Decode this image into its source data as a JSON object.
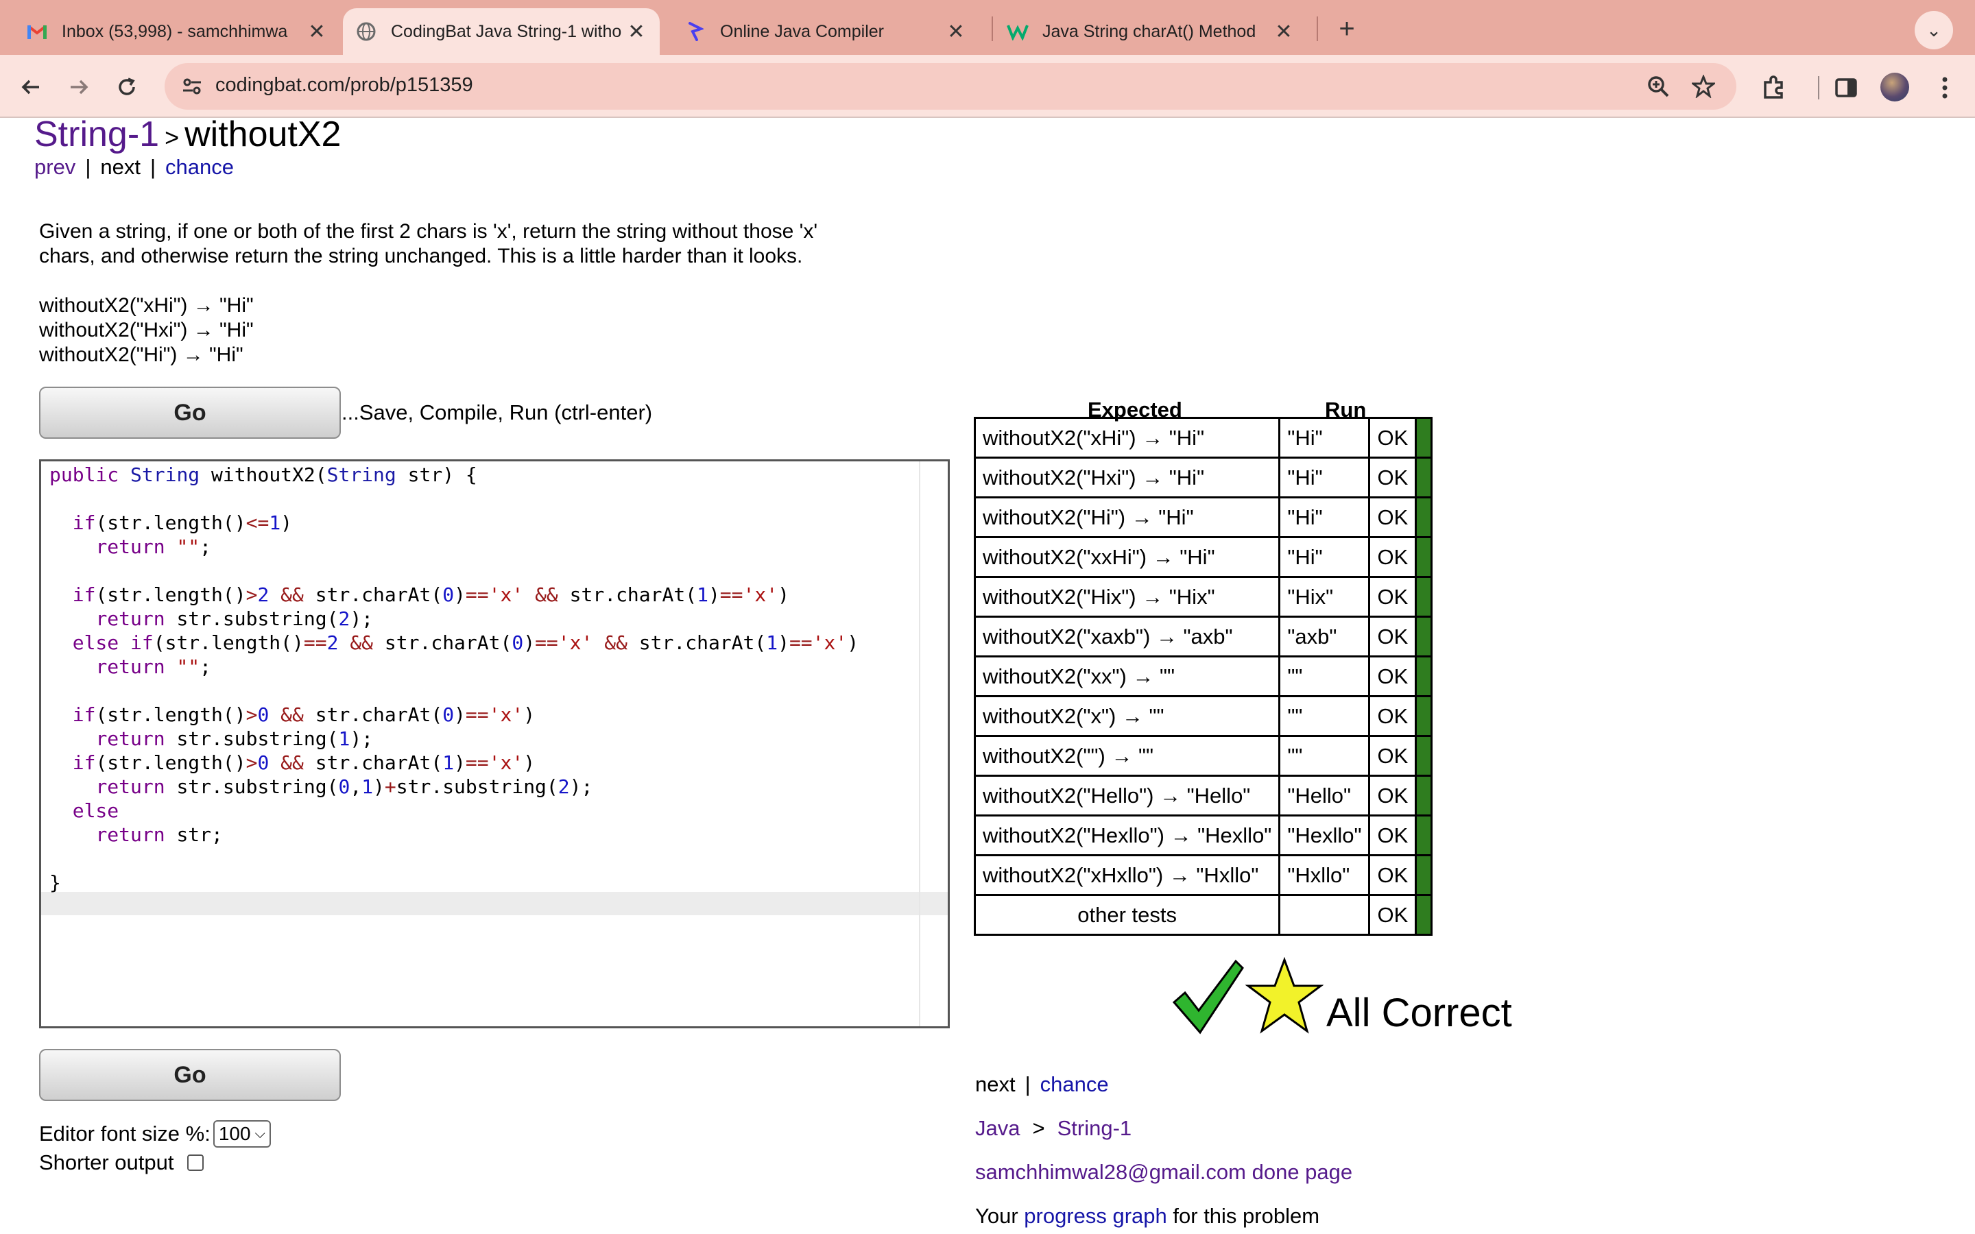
{
  "browser": {
    "tabs": [
      {
        "title": "Inbox (53,998) - samchhimwa",
        "favicon": "gmail-icon",
        "active": false
      },
      {
        "title": "CodingBat Java String-1 witho",
        "favicon": "globe-icon",
        "active": true
      },
      {
        "title": "Online Java Compiler",
        "favicon": "compiler-icon",
        "active": false
      },
      {
        "title": "Java String charAt() Method",
        "favicon": "w3schools-icon",
        "active": false
      }
    ],
    "new_tab": "+",
    "url": "codingbat.com/prob/p151359"
  },
  "breadcrumb": {
    "section": "String-1",
    "separator": ">",
    "problem": "withoutX2"
  },
  "nav": {
    "prev": "prev",
    "next": "next",
    "chance": "chance",
    "divider": "|"
  },
  "problem": {
    "description_1": "Given a string, if one or both of the first 2 chars is 'x', return the string without those 'x'",
    "description_2": "chars, and otherwise return the string unchanged. This is a little harder than it looks.",
    "examples": [
      "withoutX2(\"xHi\") → \"Hi\"",
      "withoutX2(\"Hxi\") → \"Hi\"",
      "withoutX2(\"Hi\") → \"Hi\""
    ]
  },
  "controls": {
    "go_label": "Go",
    "go_hint": "...Save, Compile, Run (ctrl-enter)",
    "font_size_label": "Editor font size %:",
    "font_size_value": "100",
    "shorter_output_label": "Shorter output",
    "shorter_output_checked": false
  },
  "results": {
    "header_expected": "Expected",
    "header_run": "Run",
    "rows": [
      {
        "expected": "withoutX2(\"xHi\") → \"Hi\"",
        "run": "\"Hi\"",
        "status": "OK"
      },
      {
        "expected": "withoutX2(\"Hxi\") → \"Hi\"",
        "run": "\"Hi\"",
        "status": "OK"
      },
      {
        "expected": "withoutX2(\"Hi\") → \"Hi\"",
        "run": "\"Hi\"",
        "status": "OK"
      },
      {
        "expected": "withoutX2(\"xxHi\") → \"Hi\"",
        "run": "\"Hi\"",
        "status": "OK"
      },
      {
        "expected": "withoutX2(\"Hix\") → \"Hix\"",
        "run": "\"Hix\"",
        "status": "OK"
      },
      {
        "expected": "withoutX2(\"xaxb\") → \"axb\"",
        "run": "\"axb\"",
        "status": "OK"
      },
      {
        "expected": "withoutX2(\"xx\") → \"\"",
        "run": "\"\"",
        "status": "OK"
      },
      {
        "expected": "withoutX2(\"x\") → \"\"",
        "run": "\"\"",
        "status": "OK"
      },
      {
        "expected": "withoutX2(\"\") → \"\"",
        "run": "\"\"",
        "status": "OK"
      },
      {
        "expected": "withoutX2(\"Hello\") → \"Hello\"",
        "run": "\"Hello\"",
        "status": "OK"
      },
      {
        "expected": "withoutX2(\"Hexllo\") → \"Hexllo\"",
        "run": "\"Hexllo\"",
        "status": "OK"
      },
      {
        "expected": "withoutX2(\"xHxllo\") → \"Hxllo\"",
        "run": "\"Hxllo\"",
        "status": "OK"
      },
      {
        "expected": "other tests",
        "run": "",
        "status": "OK"
      }
    ],
    "pass_color": "#2f7d1f",
    "all_correct": "All Correct"
  },
  "footer": {
    "next": "next",
    "chance": "chance",
    "language": "Java",
    "section": "String-1",
    "user_email": "samchhimwal28@gmail.com",
    "done_page": "done page",
    "progress_prefix": "Your",
    "progress_link": "progress graph",
    "progress_suffix": "for this problem"
  }
}
